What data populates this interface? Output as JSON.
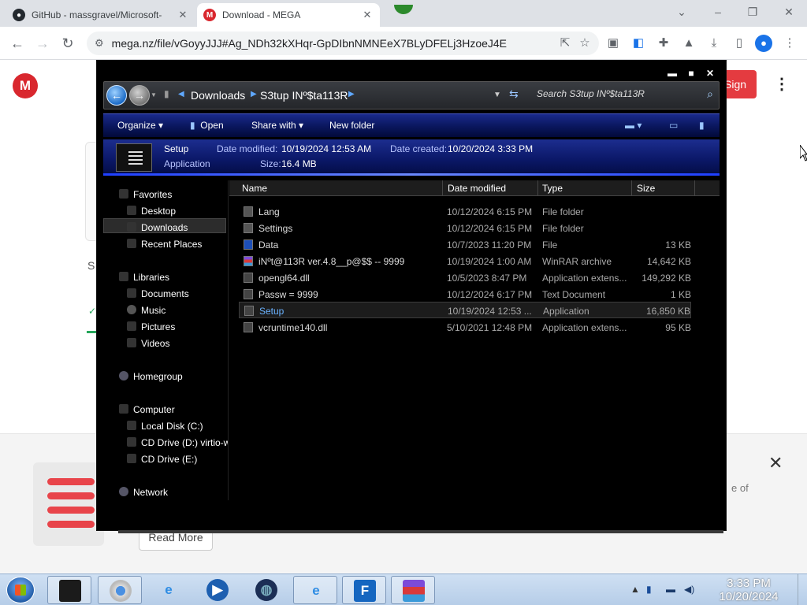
{
  "browser": {
    "tabs": [
      {
        "title": "GitHub - massgravel/Microsoft-",
        "icon": "github-icon",
        "active": false
      },
      {
        "title": "Download - MEGA",
        "icon": "mega-icon",
        "active": true
      }
    ],
    "url": "mega.nz/file/vGoyyJJJ#Ag_NDh32kXHqr-GpDIbnNMNEeX7BLyDFELj3HzoeJ4E"
  },
  "mega": {
    "logo_letter": "M",
    "signup_label": "Sign up",
    "bg_letter": "S",
    "read_more_label": "Read More",
    "banner_text": "e of",
    "accent": "#d9272e"
  },
  "explorer": {
    "breadcrumb": [
      "Downloads",
      "S3tup INº$ta113R"
    ],
    "search_placeholder": "Search S3tup INº$ta113R",
    "commands": {
      "organize": "Organize",
      "open": "Open",
      "share_with": "Share with",
      "new_folder": "New folder"
    },
    "details": {
      "name": "Setup",
      "kind": "Application",
      "date_modified_label": "Date modified:",
      "date_modified": "10/19/2024 12:53 AM",
      "date_created_label": "Date created:",
      "date_created": "10/20/2024 3:33 PM",
      "size_label": "Size:",
      "size": "16.4 MB"
    },
    "nav": {
      "favorites": "Favorites",
      "desktop": "Desktop",
      "downloads": "Downloads",
      "recent_places": "Recent Places",
      "libraries": "Libraries",
      "documents": "Documents",
      "music": "Music",
      "pictures": "Pictures",
      "videos": "Videos",
      "homegroup": "Homegroup",
      "computer": "Computer",
      "local_disk": "Local Disk (C:)",
      "cd_drive_d": "CD Drive (D:) virtio-w",
      "cd_drive_e": "CD Drive (E:)",
      "network": "Network"
    },
    "columns": {
      "name": "Name",
      "date_modified": "Date modified",
      "type": "Type",
      "size": "Size"
    },
    "files": [
      {
        "name": "Lang",
        "date": "10/12/2024 6:15 PM",
        "type": "File folder",
        "size": "",
        "icon": "folder-icon"
      },
      {
        "name": "Settings",
        "date": "10/12/2024 6:15 PM",
        "type": "File folder",
        "size": "",
        "icon": "folder-icon"
      },
      {
        "name": "Data",
        "date": "10/7/2023 11:20 PM",
        "type": "File",
        "size": "13 KB",
        "icon": "file-icon"
      },
      {
        "name": "iNºt@113R ver.4.8__p@$$ -- 9999",
        "date": "10/19/2024 1:00 AM",
        "type": "WinRAR archive",
        "size": "14,642 KB",
        "icon": "winrar-icon"
      },
      {
        "name": "opengl64.dll",
        "date": "10/5/2023 8:47 PM",
        "type": "Application extens...",
        "size": "149,292 KB",
        "icon": "dll-icon"
      },
      {
        "name": "Passw = 9999",
        "date": "10/12/2024 6:17 PM",
        "type": "Text Document",
        "size": "1 KB",
        "icon": "text-icon"
      },
      {
        "name": "Setup",
        "date": "10/19/2024 12:53 ...",
        "type": "Application",
        "size": "16,850 KB",
        "icon": "app-icon",
        "selected": true
      },
      {
        "name": "vcruntime140.dll",
        "date": "5/10/2021 12:48 PM",
        "type": "Application extens...",
        "size": "95 KB",
        "icon": "dll-icon"
      }
    ]
  },
  "taskbar": {
    "time": "3:33 PM",
    "date": "10/20/2024"
  }
}
